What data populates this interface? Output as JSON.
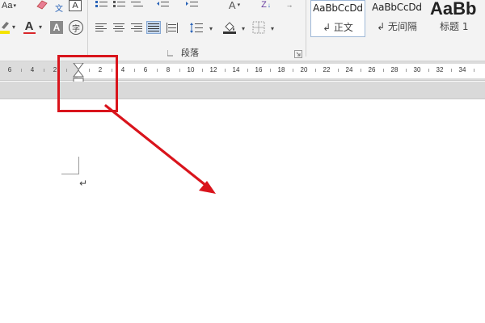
{
  "ribbon": {
    "font_group": {
      "font_dropdown_label": "Aa",
      "phonetic_label": "文",
      "char_border_label": "A",
      "font_color_label": "A",
      "char_shading_label": "A",
      "enclose_char_label": "字"
    },
    "paragraph_group": {
      "label": "段落",
      "sort_label": "Z",
      "font_size_label": "A"
    },
    "styles_gallery": [
      {
        "preview": "AaBbCcDd",
        "name": "↲ 正文",
        "selected": true
      },
      {
        "preview": "AaBbCcDd",
        "name": "↲ 无间隔",
        "selected": false
      },
      {
        "preview": "AaBb",
        "name": "标题 1",
        "selected": false
      }
    ]
  },
  "ruler": {
    "left_numbers": [
      "6",
      "4",
      "2"
    ],
    "right_numbers": [
      "2",
      "4",
      "6",
      "8",
      "10",
      "12",
      "14",
      "16",
      "18",
      "20",
      "22",
      "24",
      "26",
      "28",
      "30",
      "32",
      "34"
    ]
  },
  "document": {
    "paragraph_mark": "↵"
  },
  "colors": {
    "ribbon_bg": "#f3f3f3",
    "ruler_bg": "#dcdcdc",
    "annotation_red": "#d9141c",
    "font_color_bar": "#d9262a",
    "active_align_bg": "#c5d9f1"
  }
}
